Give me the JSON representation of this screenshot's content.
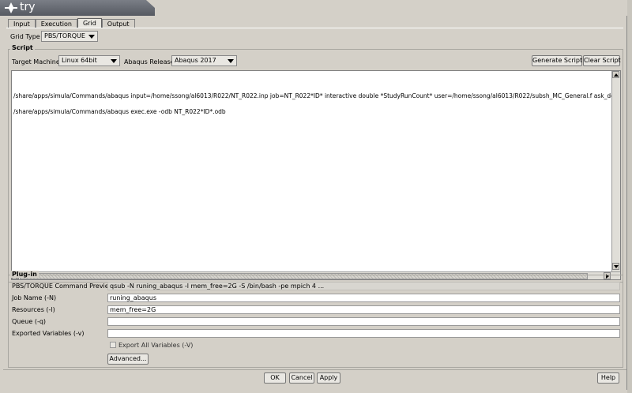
{
  "window": {
    "title": "try"
  },
  "tabs": [
    {
      "label": "Input",
      "active": false
    },
    {
      "label": "Execution",
      "active": false
    },
    {
      "label": "Grid",
      "active": true
    },
    {
      "label": "Output",
      "active": false
    }
  ],
  "grid_type": {
    "label": "Grid Type",
    "value": "PBS/TORQUE"
  },
  "script": {
    "title": "Script",
    "target_machine_label": "Target Machine",
    "target_machine_value": "Linux 64bit",
    "abaqus_release_label": "Abaqus Release",
    "abaqus_release_value": "Abaqus 2017",
    "generate_button": "Generate Script",
    "clear_button": "Clear Script",
    "lines": [
      "/share/apps/simula/Commands/abaqus input=/home/ssong/al6013/R022/NT_R022.inp job=NT_R022*ID* interactive double *StudyRunCount* user=/home/ssong/al6013/R022/subsh_MC_General.f ask_delet",
      "/share/apps/simula/Commands/abaqus exec.exe -odb NT_R022*ID*.odb"
    ]
  },
  "plugin": {
    "title": "Plug-in",
    "preview_label": "PBS/TORQUE Command Preview",
    "preview_value": "qsub -N runing_abaqus -l mem_free=2G -S /bin/bash -pe mpich 4 ...",
    "job_name_label": "Job Name (-N)",
    "job_name_value": "runing_abaqus",
    "resources_label": "Resources (-l)",
    "resources_value": "mem_free=2G",
    "queue_label": "Queue (-q)",
    "queue_value": "",
    "exported_label": "Exported Variables (-v)",
    "exported_value": "",
    "export_all_label": "Export All Variables (-V)",
    "advanced_button": "Advanced..."
  },
  "footer": {
    "ok": "OK",
    "cancel": "Cancel",
    "apply": "Apply",
    "help": "Help"
  }
}
